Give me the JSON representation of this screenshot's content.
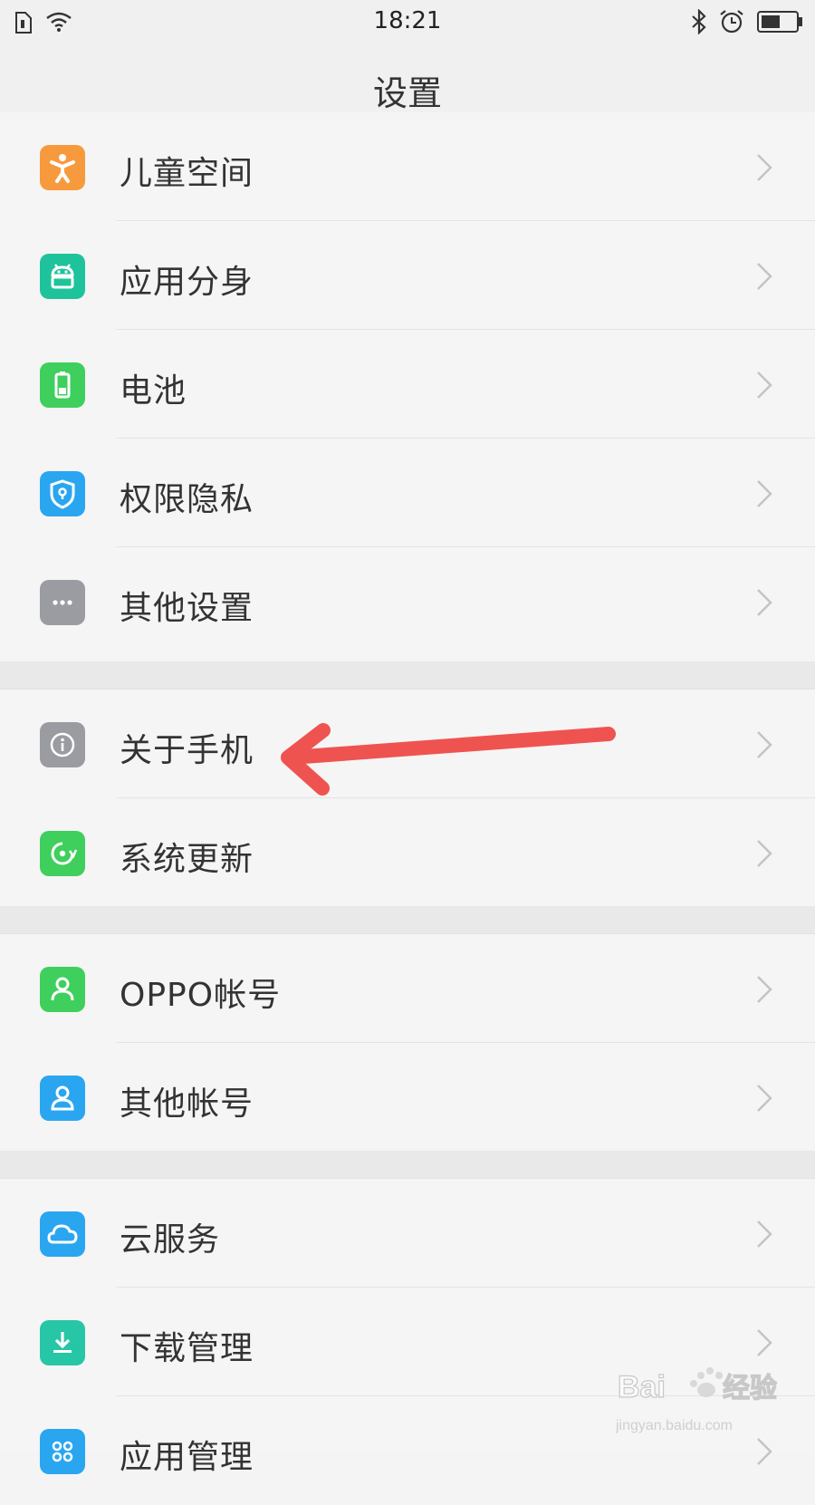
{
  "status_bar": {
    "time": "18:21",
    "left_icons": [
      "sim-icon",
      "wifi-icon"
    ],
    "right_icons": [
      "bluetooth-icon",
      "alarm-icon",
      "battery-icon"
    ]
  },
  "header": {
    "title": "设置"
  },
  "groups": [
    {
      "items": [
        {
          "label": "儿童空间",
          "icon": "child-icon",
          "color": "#f79a3e"
        },
        {
          "label": "应用分身",
          "icon": "android-clone-icon",
          "color": "#1fc39b"
        },
        {
          "label": "电池",
          "icon": "battery-icon",
          "color": "#3fcf5c"
        },
        {
          "label": "权限隐私",
          "icon": "shield-icon",
          "color": "#2aa6f0"
        },
        {
          "label": "其他设置",
          "icon": "more-icon",
          "color": "#9a9ca2"
        }
      ]
    },
    {
      "items": [
        {
          "label": "关于手机",
          "icon": "info-icon",
          "color": "#9a9ca2"
        },
        {
          "label": "系统更新",
          "icon": "update-icon",
          "color": "#3fcf5c"
        }
      ]
    },
    {
      "items": [
        {
          "label": "OPPO帐号",
          "icon": "user-icon",
          "color": "#3fcf5c"
        },
        {
          "label": "其他帐号",
          "icon": "account-icon",
          "color": "#2aa6f0"
        }
      ]
    },
    {
      "items": [
        {
          "label": "云服务",
          "icon": "cloud-icon",
          "color": "#2aa6f0"
        },
        {
          "label": "下载管理",
          "icon": "download-icon",
          "color": "#27c6a6"
        },
        {
          "label": "应用管理",
          "icon": "apps-icon",
          "color": "#2aa6f0"
        }
      ]
    }
  ],
  "annotation": {
    "arrow_color": "#ef5350"
  },
  "watermark": {
    "brand": "Baidu经验",
    "url": "jingyan.baidu.com"
  }
}
